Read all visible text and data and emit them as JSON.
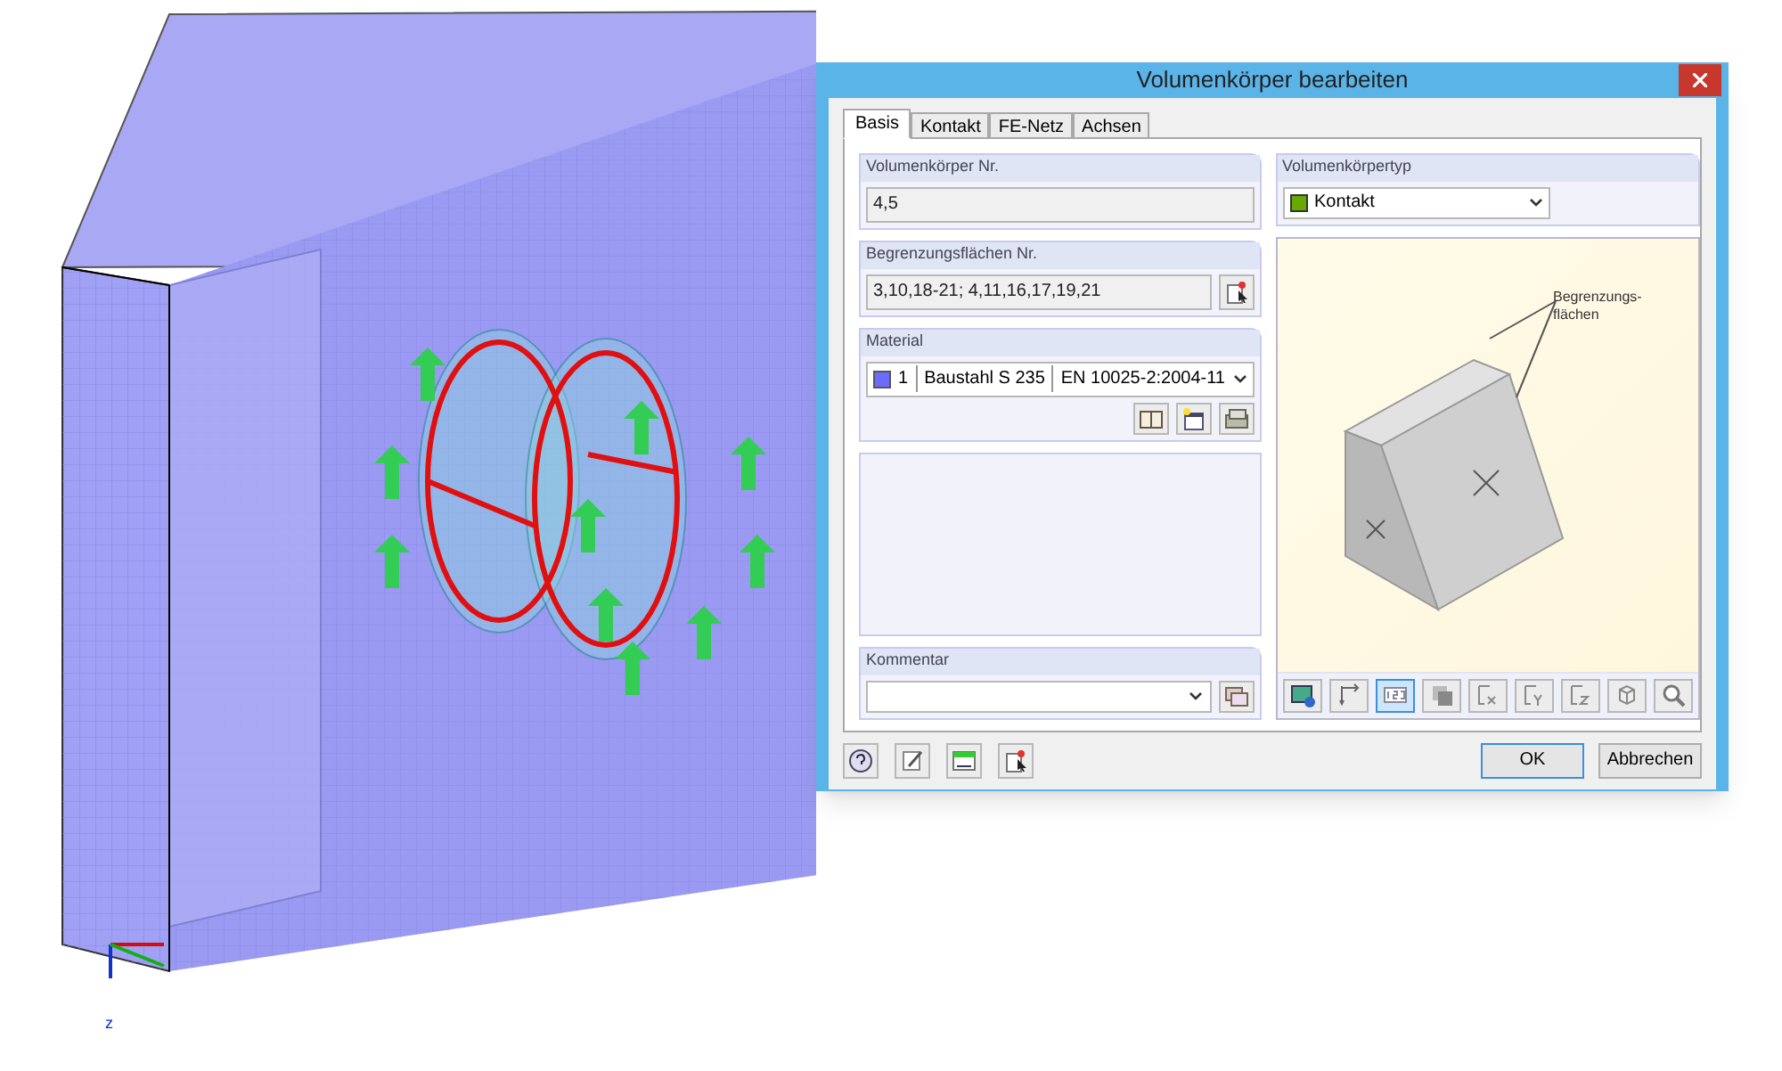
{
  "viewport": {
    "axis_label": "z"
  },
  "dialog": {
    "title": "Volumenkörper bearbeiten",
    "tabs": [
      {
        "label": "Basis",
        "selected": true
      },
      {
        "label": "Kontakt",
        "selected": false
      },
      {
        "label": "FE-Netz",
        "selected": false
      },
      {
        "label": "Achsen",
        "selected": false
      }
    ],
    "solid_no": {
      "label": "Volumenkörper Nr.",
      "value": "4,5"
    },
    "boundary_surfaces": {
      "label": "Begrenzungsflächen Nr.",
      "value": "3,10,18-21; 4,11,16,17,19,21"
    },
    "material": {
      "label": "Material",
      "number": "1",
      "name": "Baustahl S 235",
      "norm": "EN 10025-2:2004-11",
      "color": "#6b6bff"
    },
    "comment": {
      "label": "Kommentar"
    },
    "solid_type": {
      "label": "Volumenkörpertyp",
      "value": "Kontakt",
      "color": "#66aa00"
    },
    "illustration": {
      "callout": [
        "Begrenzungs-",
        "flächen"
      ]
    },
    "preview_toolbar": [
      {
        "kind": "render",
        "selected": false
      },
      {
        "kind": "dimension",
        "selected": false
      },
      {
        "kind": "numbering",
        "selected": true
      },
      {
        "kind": "shade",
        "selected": false
      },
      {
        "kind": "view-x",
        "selected": false
      },
      {
        "kind": "view-y",
        "selected": false
      },
      {
        "kind": "view-z",
        "selected": false
      },
      {
        "kind": "iso",
        "selected": false
      },
      {
        "kind": "zoom",
        "selected": false
      }
    ],
    "footer_tools": [
      {
        "kind": "help"
      },
      {
        "kind": "edit"
      },
      {
        "kind": "units"
      },
      {
        "kind": "pick"
      }
    ],
    "buttons": [
      {
        "label": "OK",
        "default": true
      },
      {
        "label": "Abbrechen",
        "default": false
      }
    ]
  }
}
